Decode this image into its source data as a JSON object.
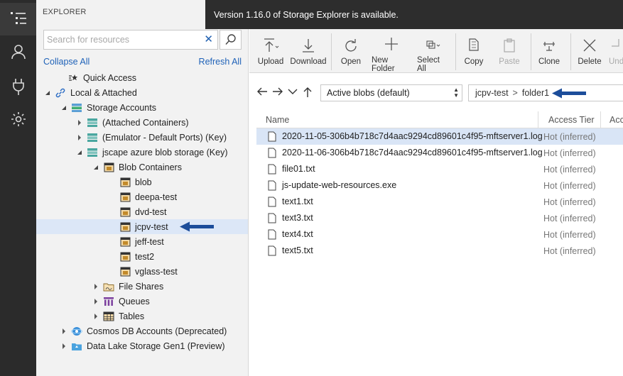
{
  "banner": {
    "text": "Version 1.16.0 of Storage Explorer is available."
  },
  "explorer": {
    "title": "EXPLORER",
    "search_placeholder": "Search for resources",
    "clear_glyph": "✕",
    "collapse_all": "Collapse All",
    "refresh_all": "Refresh All"
  },
  "tree": [
    {
      "label": "Quick Access",
      "icon": "quick-access-icon"
    },
    {
      "label": "Local & Attached",
      "icon": "link-icon"
    },
    {
      "label": "Storage Accounts",
      "icon": "storage-accounts-icon"
    },
    {
      "label": "(Attached Containers)",
      "icon": "storage-icon"
    },
    {
      "label": "(Emulator - Default Ports) (Key)",
      "icon": "storage-icon"
    },
    {
      "label": "jscape azure blob storage (Key)",
      "icon": "storage-icon"
    },
    {
      "label": "Blob Containers",
      "icon": "blob-containers-icon"
    },
    {
      "label": "blob",
      "icon": "container-icon"
    },
    {
      "label": "deepa-test",
      "icon": "container-icon"
    },
    {
      "label": "dvd-test",
      "icon": "container-icon"
    },
    {
      "label": "jcpv-test",
      "icon": "container-icon"
    },
    {
      "label": "jeff-test",
      "icon": "container-icon"
    },
    {
      "label": "test2",
      "icon": "container-icon"
    },
    {
      "label": "vglass-test",
      "icon": "container-icon"
    },
    {
      "label": "File Shares",
      "icon": "file-shares-icon"
    },
    {
      "label": "Queues",
      "icon": "queues-icon"
    },
    {
      "label": "Tables",
      "icon": "tables-icon"
    },
    {
      "label": "Cosmos DB Accounts (Deprecated)",
      "icon": "cosmos-db-icon"
    },
    {
      "label": "Data Lake Storage Gen1 (Preview)",
      "icon": "data-lake-icon"
    }
  ],
  "toolbar": {
    "upload": "Upload",
    "download": "Download",
    "open": "Open",
    "new_folder": "New Folder",
    "select_all": "Select All",
    "copy": "Copy",
    "paste": "Paste",
    "clone": "Clone",
    "delete": "Delete",
    "undelete": "Und"
  },
  "nav": {
    "view_select": "Active blobs (default)",
    "breadcrumb": [
      "jcpv-test",
      "folder1"
    ]
  },
  "grid": {
    "columns": [
      "Name",
      "Access Tier",
      "Acc"
    ],
    "rows": [
      {
        "name": "2020-11-05-306b4b718c7d4aac9294cd89601c4f95-mftserver1.log",
        "tier": "Hot (inferred)"
      },
      {
        "name": "2020-11-06-306b4b718c7d4aac9294cd89601c4f95-mftserver1.log",
        "tier": "Hot (inferred)"
      },
      {
        "name": "file01.txt",
        "tier": "Hot (inferred)"
      },
      {
        "name": "js-update-web-resources.exe",
        "tier": "Hot (inferred)"
      },
      {
        "name": "text1.txt",
        "tier": "Hot (inferred)"
      },
      {
        "name": "text3.txt",
        "tier": "Hot (inferred)"
      },
      {
        "name": "text4.txt",
        "tier": "Hot (inferred)"
      },
      {
        "name": "text5.txt",
        "tier": "Hot (inferred)"
      }
    ]
  },
  "colors": {
    "accent": "#1f62b8",
    "arrow": "#1c4d9a",
    "selection": "#dce7f7"
  }
}
